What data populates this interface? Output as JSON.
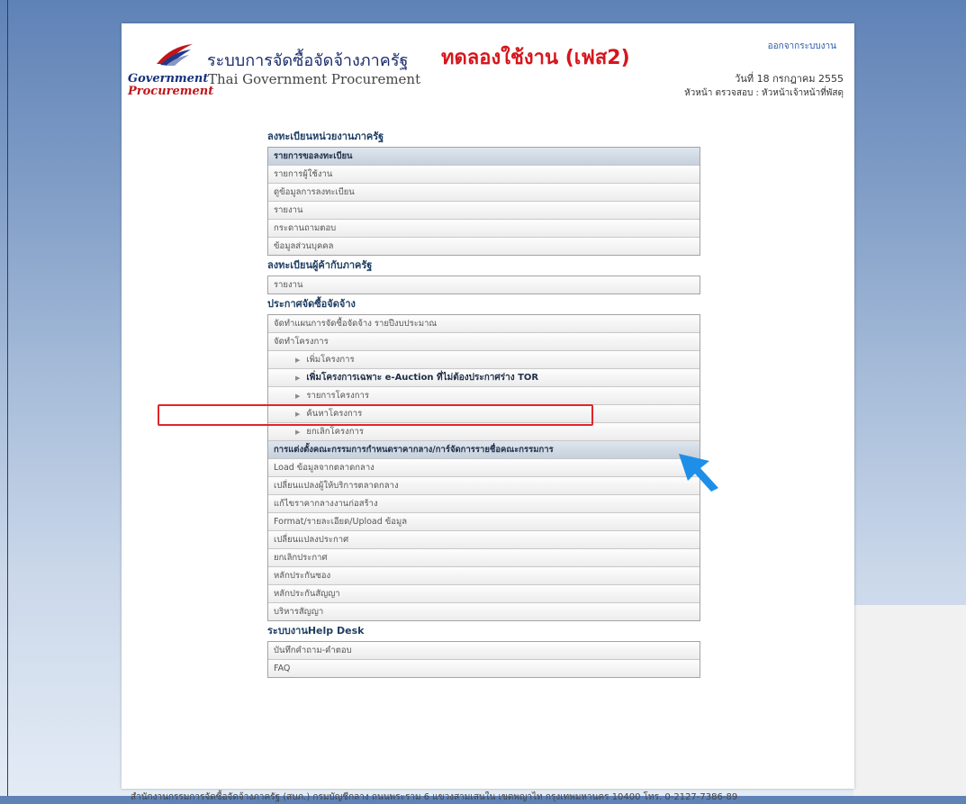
{
  "header": {
    "logo_line1": "Government",
    "logo_line2": "Procurement",
    "system_title": "ระบบการจัดซื้อจัดจ้างภาครัฐ",
    "system_subtitle": "Thai Government Procurement",
    "trial_label": "ทดลองใช้งาน (เฟส2)",
    "logout": "ออกจากระบบงาน",
    "date": "วันที่ 18 กรกฎาคม 2555",
    "user": "หัวหน้า ตรวจสอบ : หัวหน้าเจ้าหน้าที่พัสดุ"
  },
  "sections": [
    {
      "title": "ลงทะเบียนหน่วยงานภาครัฐ",
      "items": [
        {
          "label": "รายการขอลงทะเบียน",
          "type": "header"
        },
        {
          "label": "รายการผู้ใช้งาน"
        },
        {
          "label": "ดูข้อมูลการลงทะเบียน"
        },
        {
          "label": "รายงาน"
        },
        {
          "label": "กระดานถามตอบ"
        },
        {
          "label": "ข้อมูลส่วนบุคคล"
        }
      ]
    },
    {
      "title": "ลงทะเบียนผู้ค้ากับภาครัฐ",
      "items": [
        {
          "label": "รายงาน"
        }
      ]
    },
    {
      "title": "ประกาศจัดซื้อจัดจ้าง",
      "items": [
        {
          "label": "จัดทำแผนการจัดซื้อจัดจ้าง รายปีงบประมาณ"
        },
        {
          "label": "จัดทำโครงการ"
        },
        {
          "label": "เพิ่มโครงการ",
          "type": "sub"
        },
        {
          "label": "เพิ่มโครงการเฉพาะ e-Auction ที่ไม่ต้องประกาศร่าง TOR",
          "type": "sub-bold"
        },
        {
          "label": "รายการโครงการ",
          "type": "sub"
        },
        {
          "label": "ค้นหาโครงการ",
          "type": "sub"
        },
        {
          "label": "ยกเลิกโครงการ",
          "type": "sub"
        },
        {
          "label": "การแต่งตั้งคณะกรรมการกำหนดราคากลาง/การ์จัดการรายชื่อคณะกรรมการ",
          "type": "header"
        },
        {
          "label": "Load ข้อมูลจากตลาดกลาง"
        },
        {
          "label": "เปลี่ยนแปลงผู้ให้บริการตลาดกลาง"
        },
        {
          "label": "แก้ไขราคากลางงานก่อสร้าง"
        },
        {
          "label": "Format/รายละเอียด/Upload ข้อมูล"
        },
        {
          "label": "เปลี่ยนแปลงประกาศ"
        },
        {
          "label": "ยกเลิกประกาศ"
        },
        {
          "label": "หลักประกันซอง"
        },
        {
          "label": "หลักประกันสัญญา"
        },
        {
          "label": "บริหารสัญญา"
        }
      ]
    },
    {
      "title": "ระบบงานHelp Desk",
      "items": [
        {
          "label": "บันทึกคำถาม-คำตอบ"
        },
        {
          "label": "FAQ"
        }
      ]
    }
  ],
  "footer": "สำนักงานกรรมการจัดซื้อจัดจ้างภาครัฐ (สบภ.) กรมบัญชีกลาง ถนนพระราม 6 แขวงสามเสนใน เขตพญาไท กรุงเทพมหานคร 10400 โทร. 0-2127-7386-89",
  "colors": {
    "accent_red": "#d6161c",
    "navy": "#1a2d6b",
    "highlight": "#e0262b",
    "cursor": "#1e8fe8"
  },
  "icons": {
    "menu_arrow": "triangle-right",
    "pointer": "arrow-cursor"
  }
}
